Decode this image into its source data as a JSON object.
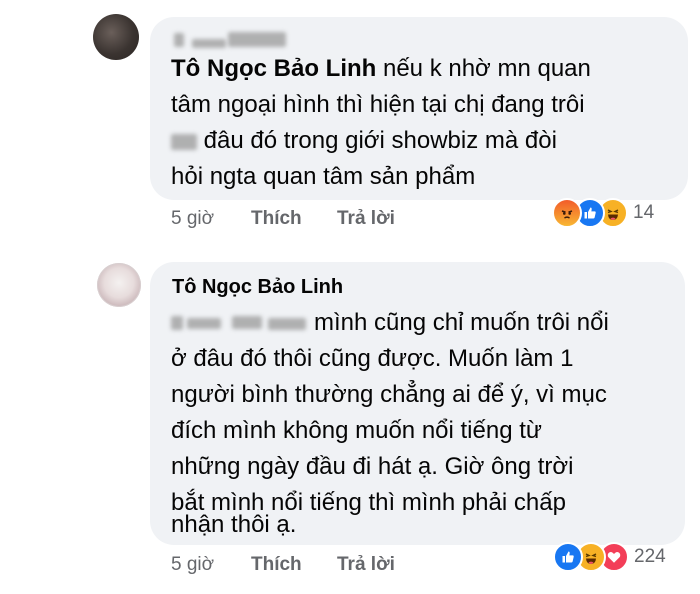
{
  "comments": [
    {
      "author_blurred": "Tên người dùng",
      "text_lines": [
        {
          "mention": "Tô Ngọc Bảo Linh",
          "text": " nếu k nhờ mn quan"
        },
        {
          "text": "tâm ngoại hình thì hiện tại chị đang trôi"
        },
        {
          "prefix_blurred": "..",
          "text": " đâu đó trong giới showbiz mà đòi"
        },
        {
          "text": "hỏi ngta quan tâm sản phẩm"
        }
      ],
      "time": "5 giờ",
      "like_label": "Thích",
      "reply_label": "Trả lời",
      "reactions": [
        "angry",
        "like",
        "haha"
      ],
      "reaction_count": "14"
    },
    {
      "author": "Tô Ngọc Bảo Linh",
      "text_lines": [
        {
          "mention_blurred": "Tên người dùng",
          "text": "mình cũng chỉ muốn trôi nổi"
        },
        {
          "text": "ở đâu đó thôi cũng được. Muốn làm 1"
        },
        {
          "text": "người bình thường chẳng ai để ý, vì mục"
        },
        {
          "text": "đích mình không muốn nổi tiếng từ"
        },
        {
          "text": "những ngày đầu đi hát ạ. Giờ ông trời"
        },
        {
          "text": "bắt mình nổi tiếng thì mình phải chấp"
        },
        {
          "text": "nhận thôi ạ."
        }
      ],
      "time": "5 giờ",
      "like_label": "Thích",
      "reply_label": "Trả lời",
      "reactions": [
        "like",
        "haha",
        "love"
      ],
      "reaction_count": "224"
    }
  ],
  "colors": {
    "bubble": "#f0f2f5",
    "meta_text": "#65676b",
    "like": "#1877f2",
    "haha": "#f7b125",
    "love": "#f33e58",
    "angry": "#f25c2a"
  }
}
